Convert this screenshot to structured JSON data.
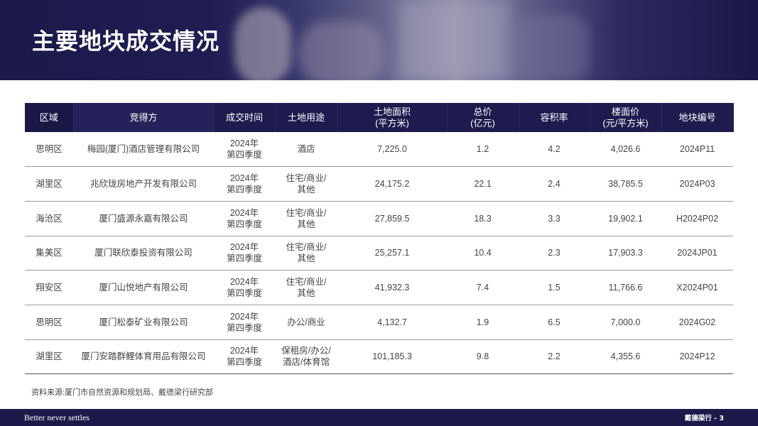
{
  "header": {
    "title": "主要地块成交情况"
  },
  "table": {
    "columns": [
      [
        "区域"
      ],
      [
        "竞得方"
      ],
      [
        "成交时间"
      ],
      [
        "土地用途"
      ],
      [
        "土地面积",
        "(平方米)"
      ],
      [
        "总价",
        "(亿元)"
      ],
      [
        "容积率"
      ],
      [
        "楼面价",
        "(元/平方米)"
      ],
      [
        "地块编号"
      ]
    ],
    "rows": [
      [
        "思明区",
        "梅园(厦门)酒店管理有限公司",
        [
          "2024年",
          "第四季度"
        ],
        [
          "酒店"
        ],
        "7,225.0",
        "1.2",
        "4.2",
        "4,026.6",
        "2024P11"
      ],
      [
        "湖里区",
        "兆欣珑房地产开发有限公司",
        [
          "2024年",
          "第四季度"
        ],
        [
          "住宅/商业/",
          "其他"
        ],
        "24,175.2",
        "22.1",
        "2.4",
        "38,785.5",
        "2024P03"
      ],
      [
        "海沧区",
        "厦门盛源永嘉有限公司",
        [
          "2024年",
          "第四季度"
        ],
        [
          "住宅/商业/",
          "其他"
        ],
        "27,859.5",
        "18.3",
        "3.3",
        "19,902.1",
        "H2024P02"
      ],
      [
        "集美区",
        "厦门联欣泰投资有限公司",
        [
          "2024年",
          "第四季度"
        ],
        [
          "住宅/商业/",
          "其他"
        ],
        "25,257.1",
        "10.4",
        "2.3",
        "17,903.3",
        "2024JP01"
      ],
      [
        "翔安区",
        "厦门山悦地产有限公司",
        [
          "2024年",
          "第四季度"
        ],
        [
          "住宅/商业/",
          "其他"
        ],
        "41,932.3",
        "7.4",
        "1.5",
        "11,766.6",
        "X2024P01"
      ],
      [
        "思明区",
        "厦门松泰矿业有限公司",
        [
          "2024年",
          "第四季度"
        ],
        [
          "办公/商业"
        ],
        "4,132.7",
        "1.9",
        "6.5",
        "7,000.0",
        "2024G02"
      ],
      [
        "湖里区",
        "厦门安踏群鲤体育用品有限公司",
        [
          "2024年",
          "第四季度"
        ],
        [
          "保租房/办公/",
          "酒店/体育馆"
        ],
        "101,185.3",
        "9.8",
        "2.2",
        "4,355.6",
        "2024P12"
      ]
    ]
  },
  "source": "资料来源:厦门市自然资源和规划局、戴德梁行研究部",
  "footer": {
    "tagline": "Better never settles",
    "page_info": "戴德梁行 - 3"
  }
}
